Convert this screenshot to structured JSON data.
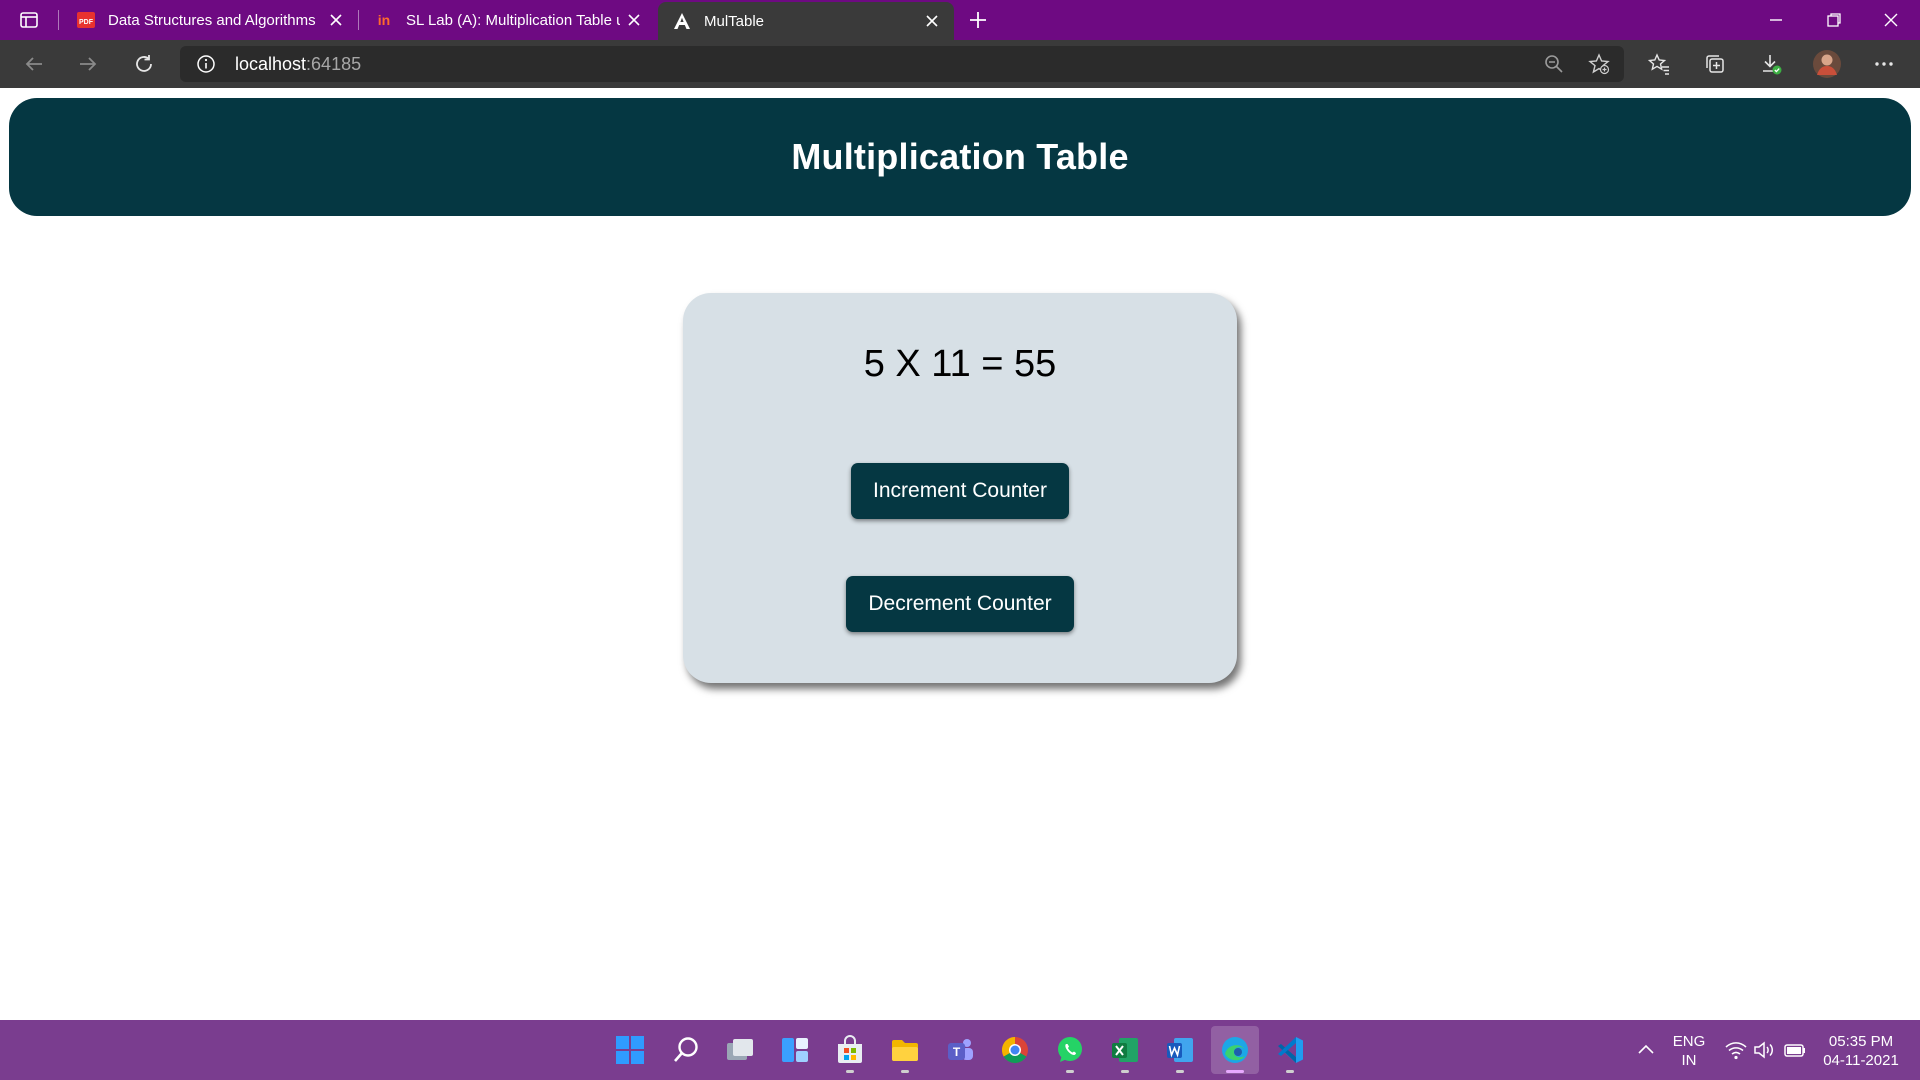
{
  "browser": {
    "tabs": [
      {
        "title": "Data Structures and Algorithms",
        "icon": "pdf-icon"
      },
      {
        "title": "SL Lab (A): Multiplication Table u",
        "icon": "site-icon"
      },
      {
        "title": "MulTable",
        "icon": "angular-icon"
      }
    ],
    "address": {
      "host": "localhost",
      "port": ":64185"
    }
  },
  "page": {
    "header_title": "Multiplication Table",
    "result": "5 X 11 = 55",
    "increment_label": "Increment Counter",
    "decrement_label": "Decrement Counter"
  },
  "colors": {
    "titlebar": "#6e0a82",
    "toolbar": "#3a3a3a",
    "header_bg": "#053742",
    "card_bg": "#d7e0e6",
    "taskbar": "#7a3d8f"
  },
  "taskbar": {
    "apps": [
      "start-icon",
      "search-icon",
      "task-view-icon",
      "widgets-icon",
      "store-icon",
      "file-explorer-icon",
      "teams-icon",
      "chrome-icon",
      "whatsapp-icon",
      "excel-icon",
      "word-icon",
      "edge-icon",
      "vscode-icon"
    ],
    "lang_line1": "ENG",
    "lang_line2": "IN",
    "time": "05:35 PM",
    "date": "04-11-2021"
  }
}
